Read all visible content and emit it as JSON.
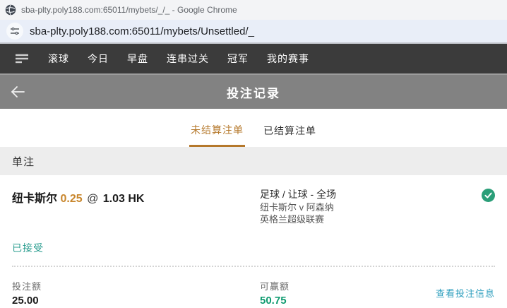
{
  "window": {
    "title": "sba-plty.poly188.com:65011/mybets/_/_ - Google Chrome",
    "favicon": "globe-logo-icon"
  },
  "address_bar": {
    "site_info_icon": "tune-icon",
    "url": "sba-plty.poly188.com:65011/mybets/Unsettled/_"
  },
  "nav": {
    "menu_icon": "hamburger-menu-icon",
    "items": [
      {
        "label": "滚球"
      },
      {
        "label": "今日"
      },
      {
        "label": "早盘"
      },
      {
        "label": "连串过关"
      },
      {
        "label": "冠军"
      },
      {
        "label": "我的赛事"
      }
    ]
  },
  "header": {
    "back_icon": "back-arrow-icon",
    "title": "投注记录"
  },
  "tabs": {
    "unsettled": "未结算注单",
    "settled": "已结算注单"
  },
  "section": {
    "title": "单注"
  },
  "bet": {
    "selection": "纽卡斯尔",
    "handicap": "0.25",
    "at_symbol": "@",
    "odds": "1.03 HK",
    "market": "足球 / 让球 - 全场",
    "event": "纽卡斯尔 v 阿森纳",
    "league": "英格兰超级联赛",
    "status_icon": "check-circle-icon",
    "status": "已接受",
    "stake_label": "投注额",
    "stake_value": "25.00",
    "win_label": "可赢额",
    "win_value": "50.75",
    "details_link": "查看投注信息"
  },
  "colors": {
    "active_tab": "#b5782b",
    "handicap_orange": "#c8862c",
    "status_teal": "#2a9d8f",
    "win_green": "#0f9b70",
    "link_blue": "#2f9fbe",
    "check_circle_green": "#2a9e78",
    "navbar_dark": "#3b3b3b",
    "header_gray": "#828282"
  }
}
